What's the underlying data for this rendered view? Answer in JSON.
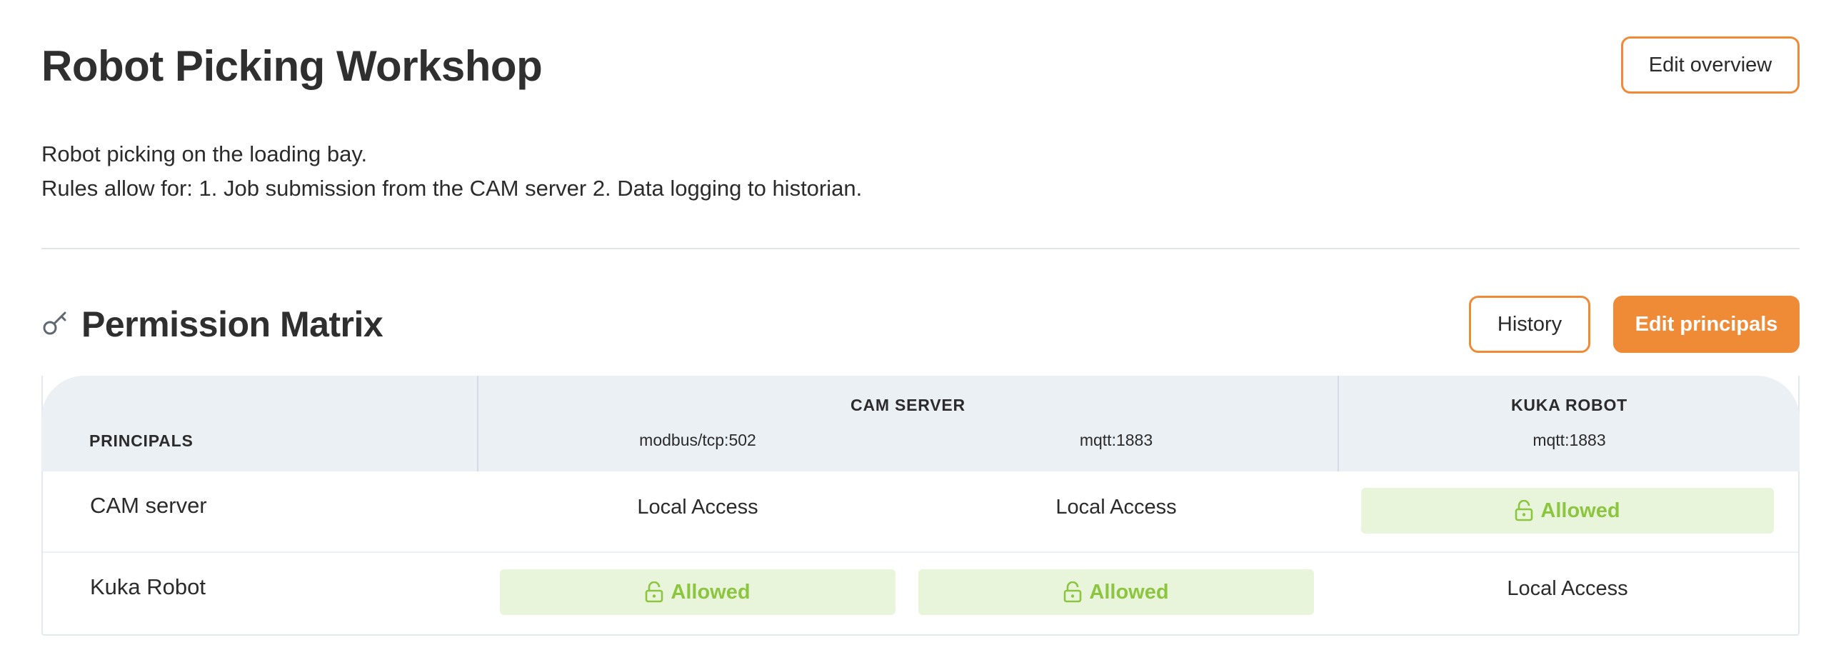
{
  "page": {
    "title": "Robot Picking Workshop",
    "edit_overview_label": "Edit overview",
    "description": [
      "Robot picking on the loading bay.",
      "Rules allow for: 1. Job submission from the CAM server 2. Data logging to historian."
    ]
  },
  "section": {
    "icon": "key-icon",
    "title": "Permission Matrix",
    "history_label": "History",
    "edit_principals_label": "Edit principals"
  },
  "matrix": {
    "principals_header": "PRINCIPALS",
    "groups": [
      {
        "name": "CAM SERVER",
        "ports": [
          "modbus/tcp:502",
          "mqtt:1883"
        ]
      },
      {
        "name": "KUKA ROBOT",
        "ports": [
          "mqtt:1883"
        ]
      }
    ],
    "rows": [
      {
        "principal": "CAM server",
        "cells": [
          "Local Access",
          "Local Access",
          "Allowed"
        ]
      },
      {
        "principal": "Kuka Robot",
        "cells": [
          "Allowed",
          "Allowed",
          "Local Access"
        ]
      }
    ]
  },
  "colors": {
    "accent": "#ef8a37",
    "allowed_text": "#8cc53f",
    "allowed_bg": "#e9f5da",
    "header_bg": "#ebf0f4"
  }
}
